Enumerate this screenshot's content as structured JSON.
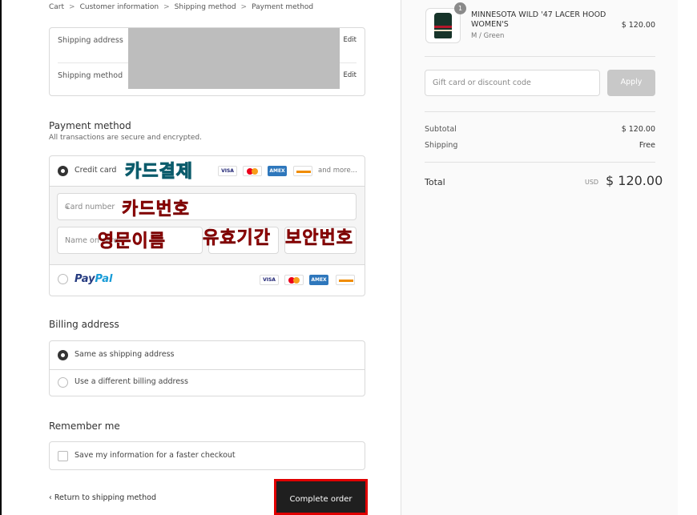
{
  "breadcrumb": {
    "cart": "Cart",
    "customer": "Customer information",
    "shipping": "Shipping method",
    "payment": "Payment method",
    "sep": ">"
  },
  "review": {
    "shipping_address_label": "Shipping address",
    "shipping_method_label": "Shipping method",
    "edit": "Edit"
  },
  "payment": {
    "title": "Payment method",
    "subtitle": "All transactions are secure and encrypted.",
    "credit_card_label": "Credit card",
    "and_more": "and more...",
    "card_number_placeholder": "Card number",
    "name_on_card_placeholder": "Name on card",
    "paypal_part1": "Pay",
    "paypal_part2": "Pal",
    "cards": [
      "VISA",
      "MC",
      "AMEX",
      "DISC"
    ]
  },
  "annotations": {
    "card_payment": "카드결제",
    "card_number": "카드번호",
    "english_name": "영문이름",
    "expiry": "유효기간",
    "security_code": "보안번호"
  },
  "billing": {
    "title": "Billing address",
    "same": "Same as shipping address",
    "different": "Use a different billing address"
  },
  "remember": {
    "title": "Remember me",
    "save": "Save my information for a faster checkout"
  },
  "footer": {
    "back": "‹ Return to shipping method",
    "complete": "Complete order"
  },
  "summary": {
    "qty": "1",
    "product_name": "MINNESOTA WILD '47 LACER HOOD WOMEN'S",
    "variant": "M / Green",
    "price": "$ 120.00",
    "gift_placeholder": "Gift card or discount code",
    "apply": "Apply",
    "subtotal_label": "Subtotal",
    "subtotal": "$ 120.00",
    "shipping_label": "Shipping",
    "shipping": "Free",
    "total_label": "Total",
    "currency": "USD",
    "total": "$ 120.00"
  },
  "colors": {
    "annotation_red": "#d01414",
    "annotation_cyan": "#10c7e6",
    "button_dark": "#1f1f1f",
    "highlight_border": "#e00000"
  }
}
